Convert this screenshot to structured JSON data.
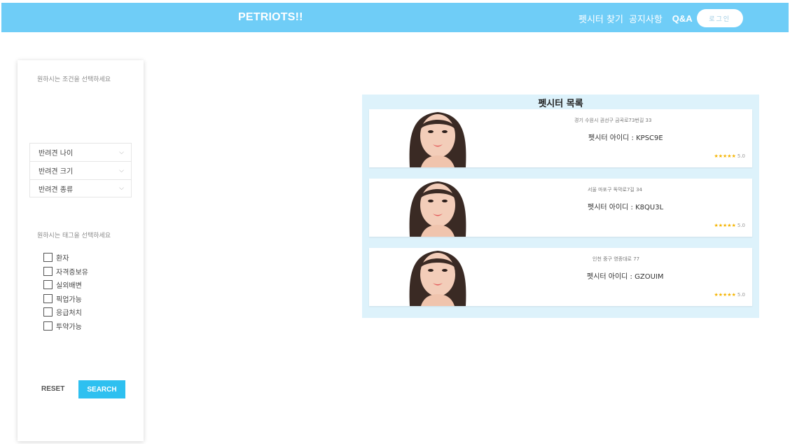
{
  "header": {
    "brand": "PETRIOTS!!",
    "nav": [
      "펫시터 찾기",
      "공지사항",
      "Q&A"
    ],
    "login_label": "로그인"
  },
  "sidebar": {
    "condition_title": "원하시는 조건을 선택하세요",
    "selects": [
      "반려견 나이",
      "반려견 크기",
      "반려견 종류"
    ],
    "tag_title": "원하시는 태그을 선택하세요",
    "tags": [
      "환자",
      "자격증보유",
      "실외배변",
      "픽업가능",
      "응급처치",
      "투약가능"
    ],
    "reset_label": "RESET",
    "search_label": "SEARCH"
  },
  "list": {
    "title": "펫시터 목록",
    "cards": [
      {
        "address": "경기 수원시 권선구 금곡로73번길 33",
        "id_text": "펫시터 아이디 : KPSC9E",
        "stars": "★★★★★",
        "score": "5.0"
      },
      {
        "address": "서울 마포구 독막로7길 34",
        "id_text": "펫시터 아이디 : K8QU3L",
        "stars": "★★★★★",
        "score": "5.0"
      },
      {
        "address": "인천 중구 영종대로 77",
        "id_text": "펫시터 아이디 : GZOUIM",
        "stars": "★★★★★",
        "score": "5.0"
      }
    ]
  },
  "colors": {
    "header_bg": "#6fcdf7",
    "search_button": "#2ec0f0",
    "list_bg": "#ddf2fb",
    "star": "#f5b400"
  }
}
